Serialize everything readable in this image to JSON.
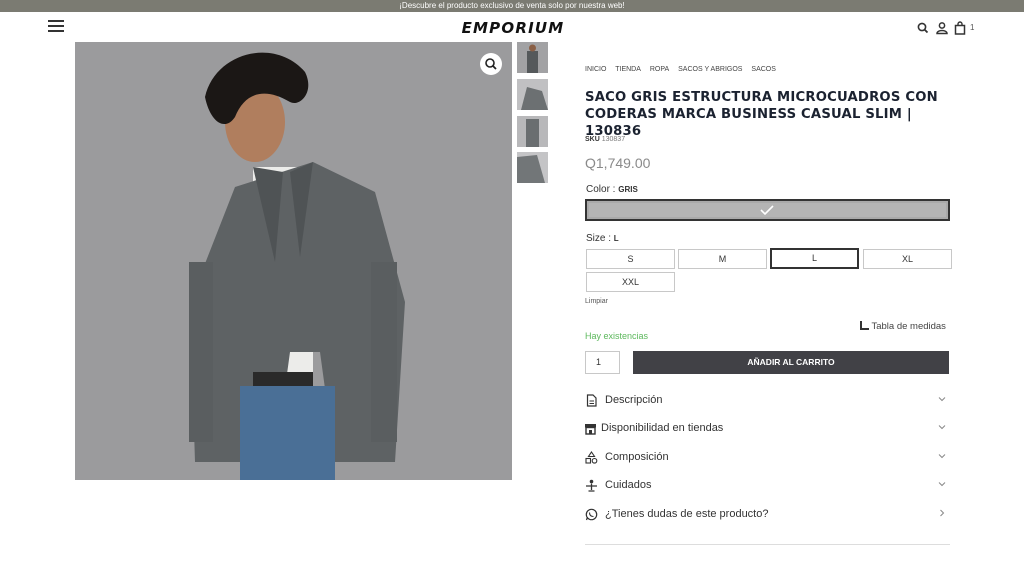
{
  "announcement": "¡Descubre el producto exclusivo de venta solo por nuestra web!",
  "header": {
    "logo": "EMPORIUM",
    "cart_count": "1"
  },
  "breadcrumb": [
    "INICIO",
    "TIENDA",
    "ROPA",
    "SACOS Y ABRIGOS",
    "SACOS"
  ],
  "product": {
    "title": "SACO GRIS ESTRUCTURA MICROCUADROS CON CODERAS MARCA BUSINESS CASUAL SLIM | 130836",
    "sku_label": "SKU",
    "sku": "130837",
    "price": "Q1,749.00",
    "color_label": "Color :",
    "color_value": "GRIS",
    "color_swatch": "#b4b4b4",
    "size_label": "Size :",
    "size_value": "L",
    "sizes": [
      "S",
      "M",
      "L",
      "XL",
      "XXL"
    ],
    "selected_size": "L",
    "clear_label": "Limpiar",
    "stock": "Hay existencias",
    "size_table": "Tabla de medidas",
    "quantity": "1",
    "add_to_cart": "AÑADIR AL CARRITO"
  },
  "accordion": [
    {
      "label": "Descripción",
      "icon": "document-icon"
    },
    {
      "label": "Disponibilidad en tiendas",
      "icon": "store-icon"
    },
    {
      "label": "Composición",
      "icon": "shapes-icon"
    },
    {
      "label": "Cuidados",
      "icon": "care-icon"
    },
    {
      "label": "¿Tienes dudas de este producto?",
      "icon": "whatsapp-icon"
    }
  ],
  "colors": {
    "accent": "#414146",
    "stock": "#5cb85c",
    "announce_bg": "#7b7b72"
  }
}
